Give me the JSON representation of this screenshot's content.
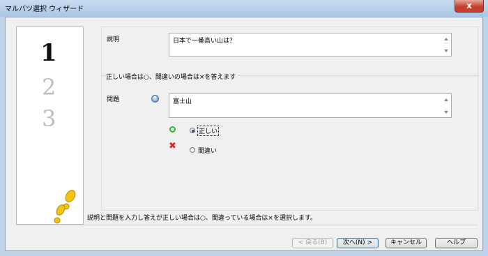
{
  "window": {
    "title": "マルバツ選択 ウィザード",
    "close_label": "x"
  },
  "sidebar": {
    "steps": [
      "1",
      "2",
      "3"
    ],
    "icon": "footprints-icon"
  },
  "explanation": {
    "label": "説明",
    "value": "日本で一番高い山は？"
  },
  "instruction": "正しい場合は○、間違いの場合は×を答えます",
  "question": {
    "label": "問題",
    "help_icon": "help-icon",
    "value": "富士山"
  },
  "answers": [
    {
      "icon": "circle-ok-icon",
      "label": "正しい",
      "selected": true
    },
    {
      "icon": "cross-ng-icon",
      "label": "間違い",
      "selected": false
    }
  ],
  "status_text": "説明と問題を入力し答えが正しい場合は○、間違っている場合は×を選択します。",
  "buttons": {
    "back": "< 戻る(B)",
    "next": "次へ(N) >",
    "cancel": "キャンセル",
    "help": "ヘルプ"
  },
  "colors": {
    "ok_green": "#2db82d",
    "ng_red": "#dd2222",
    "frame_blue": "#bcd3ea"
  }
}
